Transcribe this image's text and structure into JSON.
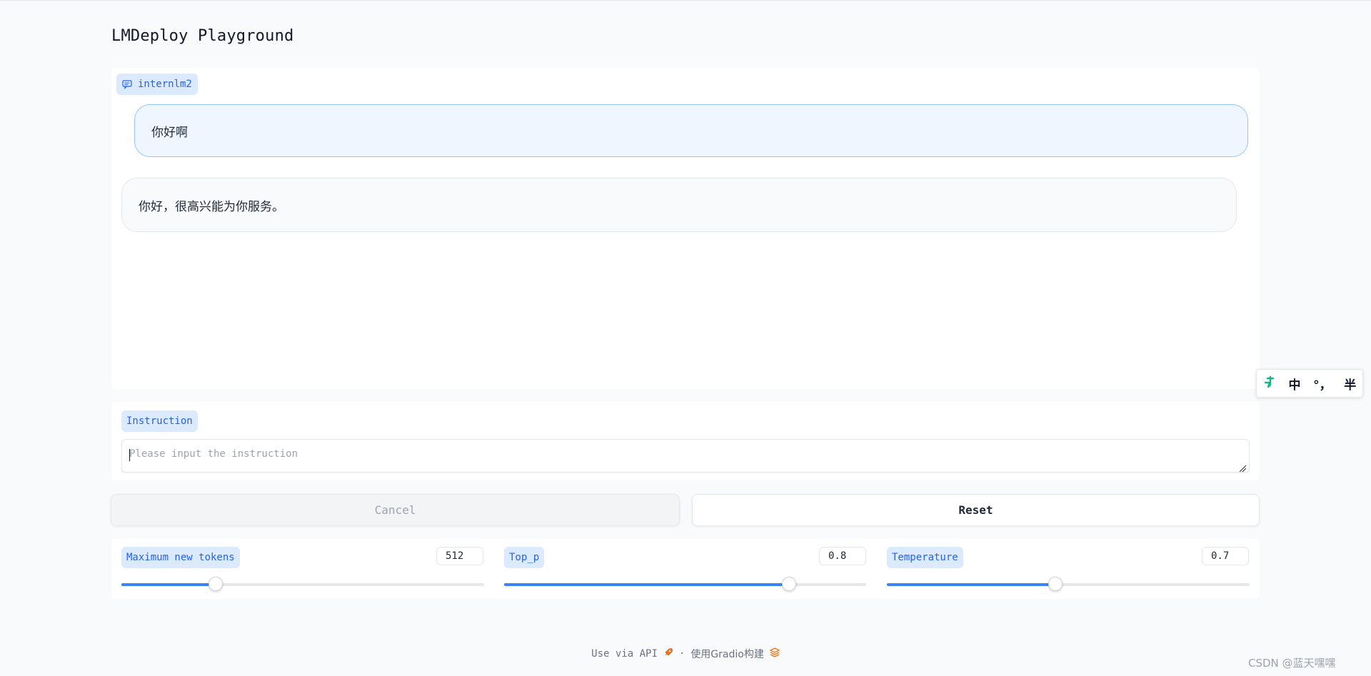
{
  "app": {
    "title": "LMDeploy Playground"
  },
  "chatbot": {
    "label": "internlm2",
    "messages": [
      {
        "role": "user",
        "text": "你好啊"
      },
      {
        "role": "assistant",
        "text": "你好，很高兴能为你服务。"
      }
    ]
  },
  "instruction": {
    "label": "Instruction",
    "placeholder": "Please input the instruction",
    "value": ""
  },
  "buttons": {
    "cancel_label": "Cancel",
    "reset_label": "Reset"
  },
  "sliders": [
    {
      "label": "Maximum new tokens",
      "value": "512",
      "fraction": 0.26
    },
    {
      "label": "Top_p",
      "value": "0.8",
      "fraction": 0.786
    },
    {
      "label": "Temperature",
      "value": "0.7",
      "fraction": 0.465
    }
  ],
  "footer": {
    "api_text": "Use via API",
    "separator": "·",
    "built_with": "使用Gradio构建"
  },
  "ime": {
    "mode": "中",
    "punct": "°，",
    "width": "半"
  },
  "watermark": "CSDN @蓝天嘿嘿",
  "colors": {
    "accent": "#3b82f6",
    "label_bg": "#dbeafe",
    "label_text": "#2563eb",
    "user_bubble": "#eff6ff",
    "user_border": "#93c5fd",
    "gradio_orange": "#f97316",
    "ime_logo": "#10b981"
  }
}
